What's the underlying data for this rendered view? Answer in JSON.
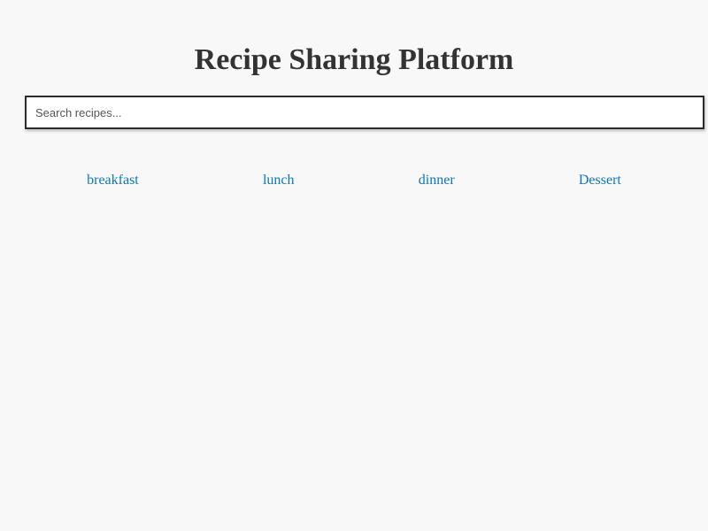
{
  "header": {
    "title": "Recipe Sharing Platform"
  },
  "search": {
    "placeholder": "Search recipes...",
    "value": ""
  },
  "categories": [
    {
      "label": "breakfast"
    },
    {
      "label": "lunch"
    },
    {
      "label": "dinner"
    },
    {
      "label": "Dessert"
    }
  ],
  "colors": {
    "background": "#f8f8f8",
    "title": "#333333",
    "link": "#0a76b8",
    "input_border": "#2b2b2b"
  }
}
